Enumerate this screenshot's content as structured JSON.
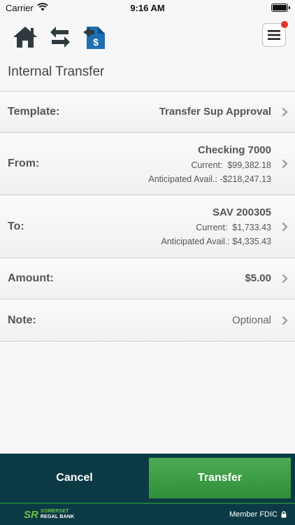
{
  "status_bar": {
    "carrier": "Carrier",
    "time": "9:16 AM"
  },
  "toolbar": {
    "icons": [
      "home-icon",
      "transfer-arrows-icon",
      "bill-pay-icon",
      "menu-icon"
    ]
  },
  "page": {
    "title": "Internal Transfer"
  },
  "form": {
    "template": {
      "label": "Template:",
      "value": "Transfer Sup Approval"
    },
    "from": {
      "label": "From:",
      "account": "Checking 7000",
      "current_label": "Current:",
      "current": "$99,382.18",
      "anticipated_label": "Anticipated Avail.:",
      "anticipated": "-$218,247.13"
    },
    "to": {
      "label": "To:",
      "account": "SAV 200305",
      "current_label": "Current:",
      "current": "$1,733.43",
      "anticipated_label": "Anticipated Avail.:",
      "anticipated": "$4,335.43"
    },
    "amount": {
      "label": "Amount:",
      "value": "$5.00"
    },
    "note": {
      "label": "Note:",
      "placeholder": "Optional"
    }
  },
  "actions": {
    "cancel": "Cancel",
    "transfer": "Transfer"
  },
  "footer": {
    "logo_mark": "SR",
    "logo_top": "SOMERSET",
    "logo_bottom": "REGAL BANK",
    "member": "Member FDIC"
  },
  "colors": {
    "bottom_bar": "#0c3a44",
    "transfer_button": "#3a9a44",
    "notification": "#e8352b",
    "bill_pay_icon": "#1d6fb0"
  }
}
